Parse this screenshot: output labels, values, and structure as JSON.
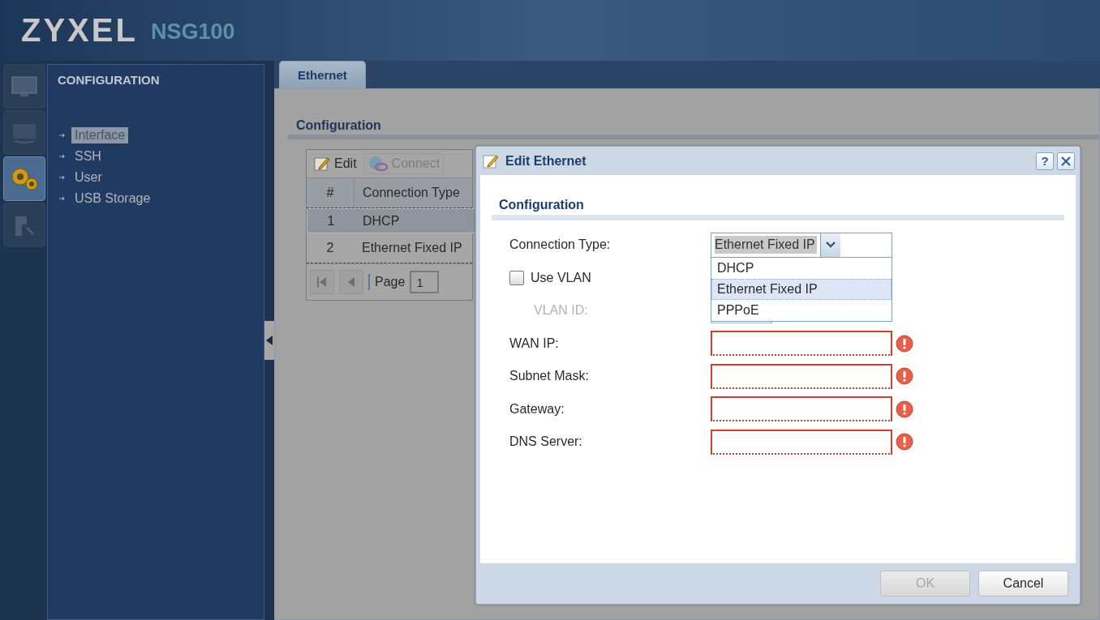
{
  "header": {
    "brand": "ZYXEL",
    "model": "NSG100"
  },
  "nav_icons": [
    {
      "kind": "monitor",
      "selected": false
    },
    {
      "kind": "screen",
      "selected": false
    },
    {
      "kind": "gears",
      "selected": true
    },
    {
      "kind": "chart",
      "selected": false
    }
  ],
  "sidebar": {
    "title": "CONFIGURATION",
    "items": [
      {
        "label": "Interface",
        "selected": true
      },
      {
        "label": "SSH",
        "selected": false
      },
      {
        "label": "User",
        "selected": false
      },
      {
        "label": "USB Storage",
        "selected": false
      }
    ]
  },
  "tabs": [
    {
      "label": "Ethernet",
      "selected": true
    }
  ],
  "section_title": "Configuration",
  "toolbar": [
    {
      "kind": "edit",
      "label": "Edit",
      "disabled": false
    },
    {
      "kind": "connect",
      "label": "Connect",
      "disabled": true
    }
  ],
  "table": {
    "columns": [
      "#",
      "Connection Type"
    ],
    "rows": [
      {
        "cells": [
          "1",
          "DHCP"
        ],
        "selected": true
      },
      {
        "cells": [
          "2",
          "Ethernet Fixed IP"
        ],
        "selected": false
      }
    ]
  },
  "pager": {
    "label": "Page",
    "value": "1"
  },
  "dialog": {
    "title": "Edit Ethernet",
    "help": "?",
    "section_title": "Configuration",
    "fields": [
      {
        "kind": "select",
        "label": "Connection Type:",
        "value": "Ethernet Fixed IP",
        "expanded": true,
        "options": [
          {
            "label": "DHCP",
            "selected": false
          },
          {
            "label": "Ethernet Fixed IP",
            "selected": true
          },
          {
            "label": "PPPoE",
            "selected": false
          }
        ]
      },
      {
        "kind": "checkbox",
        "label": "Use VLAN",
        "checked": false
      },
      {
        "kind": "text",
        "label": "VLAN ID:",
        "disabled": true,
        "invalid": false
      },
      {
        "kind": "text",
        "label": "WAN IP:",
        "disabled": false,
        "invalid": true
      },
      {
        "kind": "text",
        "label": "Subnet Mask:",
        "disabled": false,
        "invalid": true
      },
      {
        "kind": "text",
        "label": "Gateway:",
        "disabled": false,
        "invalid": true
      },
      {
        "kind": "text",
        "label": "DNS Server:",
        "disabled": false,
        "invalid": true
      }
    ],
    "buttons": [
      {
        "label": "OK",
        "disabled": true
      },
      {
        "label": "Cancel",
        "disabled": false
      }
    ]
  }
}
